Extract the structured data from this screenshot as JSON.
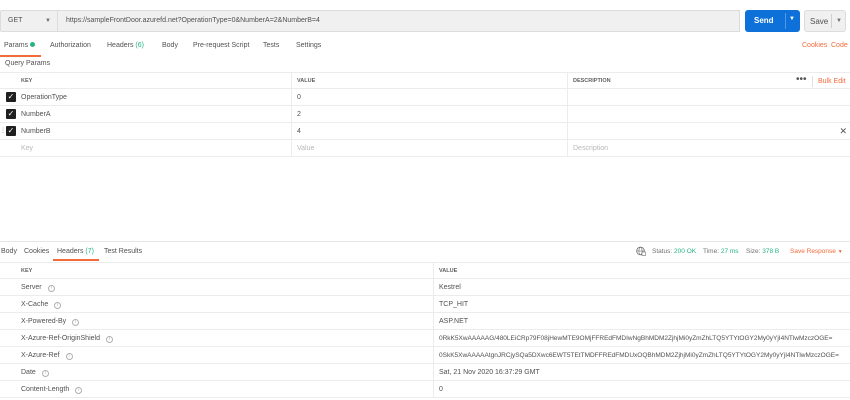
{
  "request": {
    "method": "GET",
    "url": "https://sampleFrontDoor.azurefd.net?OperationType=0&NumberA=2&NumberB=4",
    "send_label": "Send",
    "save_label": "Save"
  },
  "request_tabs": {
    "params": "Params",
    "authorization": "Authorization",
    "headers": "Headers",
    "headers_count": "(6)",
    "body": "Body",
    "prerequest": "Pre-request Script",
    "tests": "Tests",
    "settings": "Settings",
    "cookies": "Cookies",
    "code": "Code"
  },
  "query_params": {
    "title": "Query Params",
    "columns": {
      "key": "KEY",
      "value": "VALUE",
      "description": "DESCRIPTION"
    },
    "bulk_edit": "Bulk Edit",
    "rows": [
      {
        "key": "OperationType",
        "value": "0"
      },
      {
        "key": "NumberA",
        "value": "2"
      },
      {
        "key": "NumberB",
        "value": "4"
      }
    ],
    "placeholder": {
      "key": "Key",
      "value": "Value",
      "description": "Description"
    }
  },
  "response_tabs": {
    "body": "Body",
    "cookies": "Cookies",
    "headers": "Headers",
    "headers_count": "(7)",
    "test_results": "Test Results"
  },
  "response_status": {
    "status_label": "Status:",
    "status_value": "200 OK",
    "time_label": "Time:",
    "time_value": "27 ms",
    "size_label": "Size:",
    "size_value": "378 B",
    "save_response": "Save Response"
  },
  "response_headers": {
    "columns": {
      "key": "KEY",
      "value": "VALUE"
    },
    "rows": [
      {
        "key": "Server",
        "value": "Kestrel"
      },
      {
        "key": "X-Cache",
        "value": "TCP_HIT"
      },
      {
        "key": "X-Powered-By",
        "value": "ASP.NET"
      },
      {
        "key": "X-Azure-Ref-OriginShield",
        "value": "0RkK5XwAAAAAG/480LEiCRp79F08jHewMTE9OMjFFREdFMDIwNgBhMDM2ZjhjMi0yZmZhLTQ5YTYtOGY2My0yYjI4NTlwMzczOGE="
      },
      {
        "key": "X-Azure-Ref",
        "value": "0SkK5XwAAAAAtgnJRCjySQa5DXwc6EWT5TEtTMDFFREdFMDUxOQBhMDM2ZjhjMi0yZmZhLTQ5YTYtOGY2My0yYjI4NTlwMzczOGE="
      },
      {
        "key": "Date",
        "value": "Sat, 21 Nov 2020 16:37:29 GMT"
      },
      {
        "key": "Content-Length",
        "value": "0"
      }
    ]
  },
  "colors": {
    "accent": "#f26b3a",
    "send": "#0d71d9",
    "success": "#26b47f"
  }
}
